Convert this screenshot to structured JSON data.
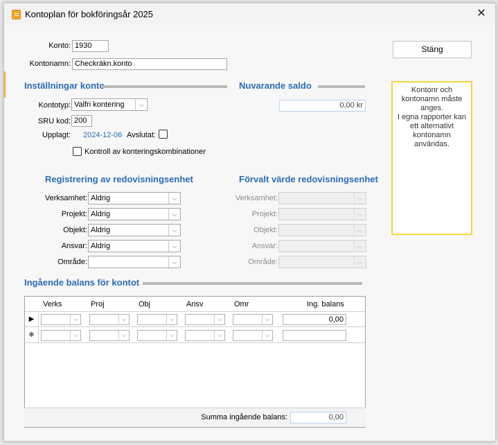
{
  "window": {
    "title": "Kontoplan för bokföringsår 2025",
    "close_glyph": "✕"
  },
  "icons": {
    "app": "ledger-book-icon",
    "close": "close-icon",
    "dropdown": "chevron-down-icon",
    "current_row": "row-pointer-icon",
    "new_row": "new-row-icon"
  },
  "colors": {
    "heading": "#2b6cb5",
    "info_border": "#f5d43b",
    "date": "#2b6cb5"
  },
  "konto": {
    "label": "Konto:",
    "value": "1930"
  },
  "kontonamn": {
    "label": "Kontonamn:",
    "value": "Checkräkn.konto"
  },
  "close_button": {
    "label": "Stäng"
  },
  "info": {
    "text_lines": [
      "Kontonr och",
      "kontonamn måste",
      "anges.",
      "I egna rapporter kan",
      "ett alternativt",
      "kontonamn användas."
    ]
  },
  "settings": {
    "heading": "Inställningar konto",
    "kontotyp_label": "Kontotyp:",
    "kontotyp_value": "Valfri kontering",
    "sru_label": "SRU kod:",
    "sru_value": "200",
    "upplagt_label": "Upplagt:",
    "upplagt_value": "2024-12-06",
    "avslutat_label": "Avslutat:",
    "kontroll_label": "Kontroll av konteringskombinationer"
  },
  "saldo": {
    "heading": "Nuvarande saldo",
    "value": "0,00 kr"
  },
  "registrering": {
    "heading": "Registrering av redovisningsenhet",
    "rows": [
      {
        "label": "Verksamhet:",
        "value": "Aldrig"
      },
      {
        "label": "Projekt:",
        "value": "Aldrig"
      },
      {
        "label": "Objekt:",
        "value": "Aldrig"
      },
      {
        "label": "Ansvar:",
        "value": "Aldrig"
      },
      {
        "label": "Område:",
        "value": ""
      }
    ]
  },
  "forvalt": {
    "heading": "Förvalt värde redovisningsenhet",
    "rows": [
      {
        "label": "Verksamhet:"
      },
      {
        "label": "Projekt:"
      },
      {
        "label": "Objekt:"
      },
      {
        "label": "Ansvar:"
      },
      {
        "label": "Område:"
      }
    ]
  },
  "ingaende": {
    "heading": "Ingående balans för kontot",
    "columns": [
      "Verks",
      "Proj",
      "Obj",
      "Ansv",
      "Omr",
      "Ing. balans"
    ],
    "rows": [
      {
        "marker": "▶",
        "balans": "0,00"
      },
      {
        "marker": "✱",
        "balans": ""
      }
    ],
    "summa_label": "Summa ingående balans:",
    "summa_value": "0,00"
  }
}
